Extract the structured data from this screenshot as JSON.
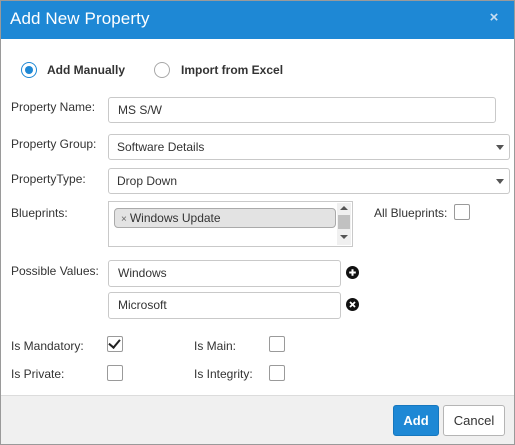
{
  "dialog": {
    "title": "Add New Property",
    "close_symbol": "×"
  },
  "mode": {
    "manual_label": "Add Manually",
    "excel_label": "Import from Excel",
    "selected": "manual"
  },
  "form": {
    "property_name_label": "Property Name:",
    "property_name_value": "MS S/W",
    "property_group_label": "Property Group:",
    "property_group_value": "Software Details",
    "property_type_label": "PropertyType:",
    "property_type_value": "Drop Down",
    "blueprints_label": "Blueprints:",
    "blueprints_selected": [
      "Windows Update"
    ],
    "all_blueprints_label": "All Blueprints:",
    "all_blueprints_checked": false,
    "possible_values_label": "Possible Values:",
    "possible_values": [
      "Windows",
      "Microsoft"
    ],
    "is_mandatory_label": "Is Mandatory:",
    "is_mandatory_checked": true,
    "is_main_label": "Is Main:",
    "is_main_checked": false,
    "is_private_label": "Is Private:",
    "is_private_checked": false,
    "is_integrity_label": "Is Integrity:",
    "is_integrity_checked": false
  },
  "footer": {
    "add_label": "Add",
    "cancel_label": "Cancel"
  },
  "icons": {
    "add_value": "plus-circle-icon",
    "remove_value": "x-circle-icon",
    "chip_remove": "x-icon"
  },
  "colors": {
    "accent": "#1e88d5",
    "header_text": "#ffffff",
    "footer_bg": "#f0f0f0"
  }
}
